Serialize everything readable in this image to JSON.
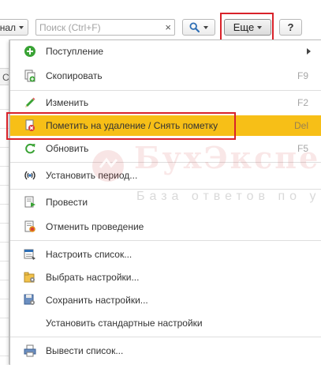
{
  "toolbar": {
    "journal_label": "нал",
    "search_placeholder": "Поиск (Ctrl+F)",
    "clear_label": "×",
    "more_label": "Еще",
    "help_label": "?"
  },
  "left_column": {
    "header_fragment": "С"
  },
  "menu": {
    "items": [
      {
        "label": "Поступление",
        "shortcut": "",
        "icon": "plus-circle-icon",
        "submenu": true
      },
      {
        "label": "Скопировать",
        "shortcut": "F9",
        "icon": "copy-icon"
      },
      {
        "label": "Изменить",
        "shortcut": "F2",
        "icon": "pencil-icon"
      },
      {
        "label": "Пометить на удаление / Снять пометку",
        "shortcut": "Del",
        "icon": "mark-delete-icon",
        "highlighted": true
      },
      {
        "label": "Обновить",
        "shortcut": "F5",
        "icon": "refresh-icon"
      },
      {
        "label": "Установить период...",
        "shortcut": "",
        "icon": "period-icon"
      },
      {
        "label": "Провести",
        "shortcut": "",
        "icon": "post-icon"
      },
      {
        "label": "Отменить проведение",
        "shortcut": "",
        "icon": "unpost-icon"
      },
      {
        "label": "Настроить список...",
        "shortcut": "",
        "icon": "configure-list-icon"
      },
      {
        "label": "Выбрать настройки...",
        "shortcut": "",
        "icon": "select-settings-icon"
      },
      {
        "label": "Сохранить настройки...",
        "shortcut": "",
        "icon": "save-settings-icon"
      },
      {
        "label": "Установить стандартные настройки",
        "shortcut": "",
        "icon": "none"
      },
      {
        "label": "Вывести список...",
        "shortcut": "",
        "icon": "print-list-icon"
      }
    ]
  },
  "watermark": {
    "brand": "БухЭксперт",
    "tagline": "База ответов по учету"
  },
  "colors": {
    "highlight_row": "#f7bf17",
    "annotation_red": "#d9222a",
    "accent_green": "#3aa335",
    "accent_blue": "#2f6fb5"
  }
}
